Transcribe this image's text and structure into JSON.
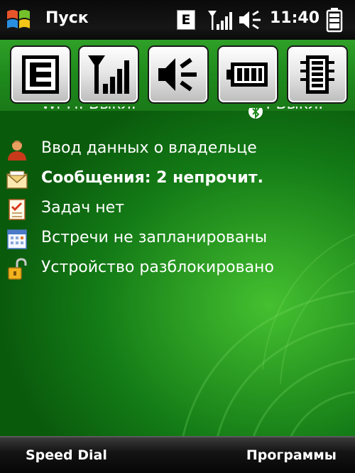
{
  "topbar": {
    "title": "Пуск",
    "network_type": "E",
    "time": "11:40"
  },
  "icons": {
    "start": "windows-flag-icon",
    "signal": "signal-strength-icon",
    "volume": "volume-icon",
    "battery": "battery-icon",
    "edge": "edge-data-icon",
    "memory": "memory-chip-icon"
  },
  "partial_row": {
    "left": "Wi-Fi: Выкл.",
    "right": ": Выкл."
  },
  "today_items": [
    {
      "label": "Ввод данных о владельце",
      "icon": "owner-icon",
      "bold": false
    },
    {
      "label": "Сообщения: 2 непрочит.",
      "icon": "messages-envelope-icon",
      "bold": true
    },
    {
      "label": "Задач нет",
      "icon": "tasks-icon",
      "bold": false
    },
    {
      "label": "Встречи не запланированы",
      "icon": "calendar-icon",
      "bold": false
    },
    {
      "label": "Устройство разблокировано",
      "icon": "unlocked-padlock-icon",
      "bold": false
    }
  ],
  "softkeys": {
    "left": "Speed Dial",
    "right": "Программы"
  },
  "colors": {
    "background_green": "#1e8a1c",
    "bar_black": "#0a0a0a"
  }
}
